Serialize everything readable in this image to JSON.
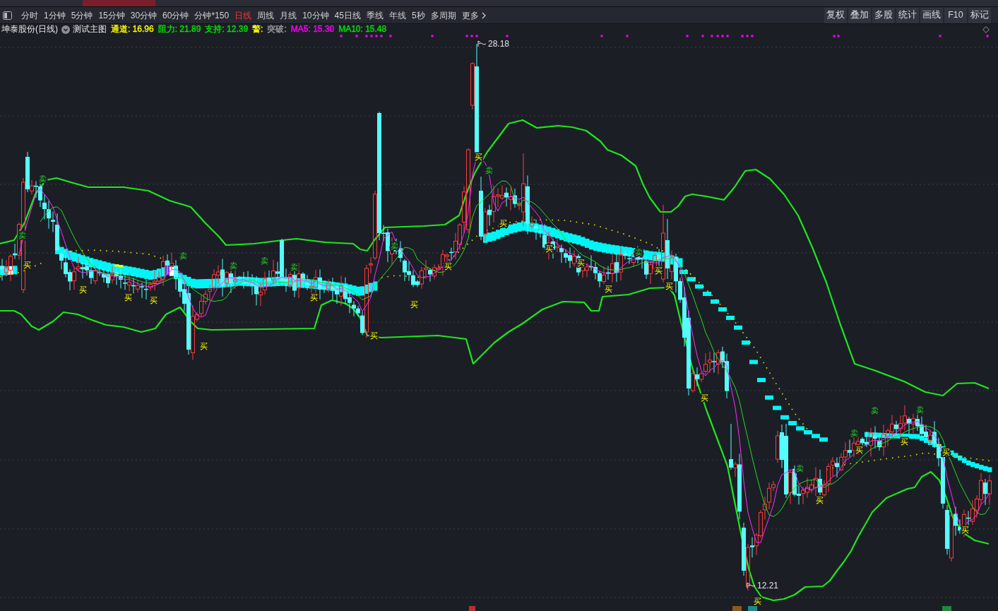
{
  "toolbar": {
    "periods": [
      {
        "label": "分时",
        "selected": false
      },
      {
        "label": "1分钟",
        "selected": false
      },
      {
        "label": "5分钟",
        "selected": false
      },
      {
        "label": "15分钟",
        "selected": false
      },
      {
        "label": "30分钟",
        "selected": false
      },
      {
        "label": "60分钟",
        "selected": false
      },
      {
        "label": "分钟*150",
        "selected": false
      },
      {
        "label": "日线",
        "selected": true
      },
      {
        "label": "周线",
        "selected": false
      },
      {
        "label": "月线",
        "selected": false
      },
      {
        "label": "10分钟",
        "selected": false
      },
      {
        "label": "45日线",
        "selected": false
      },
      {
        "label": "季线",
        "selected": false
      },
      {
        "label": "年线",
        "selected": false
      },
      {
        "label": "5秒",
        "selected": false
      },
      {
        "label": "多周期",
        "selected": false
      }
    ],
    "more": {
      "label": "更多"
    },
    "tools": [
      "复权",
      "叠加",
      "多股",
      "统计",
      "画线",
      "F10",
      "标记"
    ]
  },
  "info_bar": {
    "stock": "坤泰股份(日线)",
    "template": "测试主图",
    "indicators": [
      {
        "text": "通道: 16.96",
        "color": "#ffff00"
      },
      {
        "text": "阻力: 21.89",
        "color": "#00e600"
      },
      {
        "text": "支持: 12.39",
        "color": "#00e600"
      },
      {
        "text": "警:",
        "color": "#ffff00"
      },
      {
        "text": "突破:",
        "color": "#a0a0a0"
      },
      {
        "text": "MA5: 15.30",
        "color": "#ff00ff"
      },
      {
        "text": "MA10: 15.48",
        "color": "#00e600"
      }
    ]
  },
  "chart": {
    "price_marks": [
      {
        "text": "28.18"
      },
      {
        "text": "12.21"
      }
    ],
    "signals": [
      {
        "kind": "sell",
        "label": "卖"
      },
      {
        "kind": "buy",
        "label": "买"
      },
      {
        "kind": "sell",
        "label": "卖"
      },
      {
        "kind": "buy",
        "label": "买"
      },
      {
        "kind": "buy",
        "label": "买"
      },
      {
        "kind": "buy",
        "label": "买"
      },
      {
        "kind": "sell",
        "label": "卖"
      },
      {
        "kind": "buy",
        "label": "买"
      },
      {
        "kind": "sell",
        "label": "卖"
      },
      {
        "kind": "sell",
        "label": "卖"
      },
      {
        "kind": "sell",
        "label": "卖"
      },
      {
        "kind": "buy",
        "label": "买"
      },
      {
        "kind": "buy",
        "label": "买"
      },
      {
        "kind": "sell",
        "label": "卖"
      },
      {
        "kind": "buy",
        "label": "买"
      },
      {
        "kind": "buy",
        "label": "买"
      },
      {
        "kind": "buy",
        "label": "买"
      },
      {
        "kind": "sell",
        "label": "卖"
      },
      {
        "kind": "buy",
        "label": "买"
      },
      {
        "kind": "buy",
        "label": "买"
      },
      {
        "kind": "buy",
        "label": "买"
      },
      {
        "kind": "buy",
        "label": "买"
      },
      {
        "kind": "sell",
        "label": "卖"
      },
      {
        "kind": "buy",
        "label": "买"
      },
      {
        "kind": "buy",
        "label": "买"
      },
      {
        "kind": "buy",
        "label": "买"
      },
      {
        "kind": "buy",
        "label": "买"
      },
      {
        "kind": "sell",
        "label": "卖"
      },
      {
        "kind": "buy",
        "label": "买"
      },
      {
        "kind": "sell",
        "label": "卖"
      },
      {
        "kind": "buy",
        "label": "买"
      },
      {
        "kind": "sell",
        "label": "卖"
      },
      {
        "kind": "buy",
        "label": "买"
      },
      {
        "kind": "sell",
        "label": "卖"
      },
      {
        "kind": "buy",
        "label": "买"
      },
      {
        "kind": "buy",
        "label": "买"
      }
    ]
  }
}
